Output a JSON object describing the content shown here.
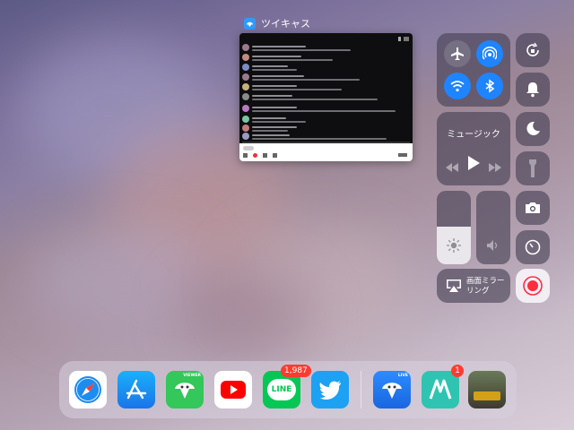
{
  "app_card": {
    "title": "ツイキャス"
  },
  "control_center": {
    "music": {
      "title": "ミュージック"
    },
    "screen_mirroring": {
      "label": "画面ミラー\nリング"
    }
  },
  "dock": {
    "apps": [
      {
        "name": "Safari"
      },
      {
        "name": "App Store"
      },
      {
        "name": "TwitCasting Viewer",
        "label": "VIEWER"
      },
      {
        "name": "YouTube"
      },
      {
        "name": "LINE",
        "label": "LINE",
        "badge": "1,987"
      },
      {
        "name": "Twitter"
      },
      {
        "name": "TwitCasting Live",
        "label": "LIVE"
      },
      {
        "name": "Mirrativ",
        "badge": "1"
      },
      {
        "name": "PUBG Mobile"
      }
    ]
  },
  "colors": {
    "accent_blue": "#1e84ff",
    "record_red": "#ff2d40",
    "badge_red": "#ff3b30"
  }
}
